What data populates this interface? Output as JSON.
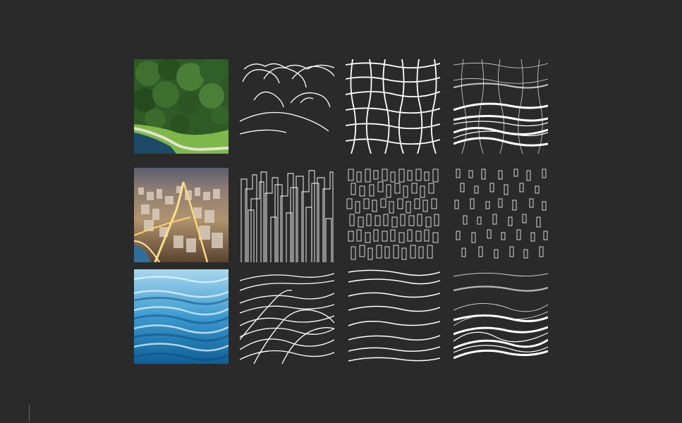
{
  "colors": {
    "background": "#2a2a2a",
    "line": "#ffffff",
    "caption_text": "#9a9a9a"
  },
  "rows": [
    {
      "photo_icon": "park-aerial-photo",
      "pattern_icons": [
        "hills-outline-pattern",
        "organic-grid-pattern",
        "layered-grid-waves-pattern"
      ]
    },
    {
      "photo_icon": "city-night-aerial-photo",
      "pattern_icons": [
        "tower-outlines-pattern",
        "dense-rectangles-pattern",
        "sparse-rectangles-pattern"
      ]
    },
    {
      "photo_icon": "water-ripples-photo",
      "pattern_icons": [
        "overlapping-waves-pattern",
        "parallel-waves-pattern",
        "layered-waves-pattern"
      ]
    }
  ]
}
